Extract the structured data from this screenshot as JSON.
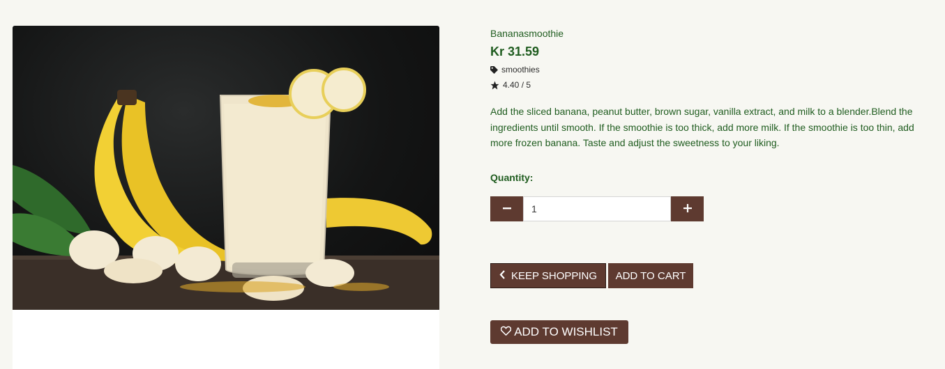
{
  "product": {
    "name": "Bananasmoothie",
    "price": "Kr 31.59",
    "category": "smoothies",
    "rating": "4.40 / 5",
    "description": "Add the sliced banana, peanut butter, brown sugar, vanilla extract, and milk to a blender.Blend the ingredients until smooth. If the smoothie is too thick, add more milk. If the smoothie is too thin, add more frozen banana. Taste and adjust the sweetness to your liking.",
    "image_icon": "banana-smoothie-photo"
  },
  "quantity": {
    "label": "Quantity:",
    "value": "1",
    "decrement_icon": "minus-icon",
    "increment_icon": "plus-icon"
  },
  "actions": {
    "keep_shopping": "KEEP SHOPPING",
    "add_to_cart": "ADD TO CART",
    "add_to_wishlist": "ADD TO WISHLIST"
  },
  "colors": {
    "accent_brown": "#5e3a30",
    "text_green": "#1f5c1f",
    "background": "#f7f7f2"
  }
}
